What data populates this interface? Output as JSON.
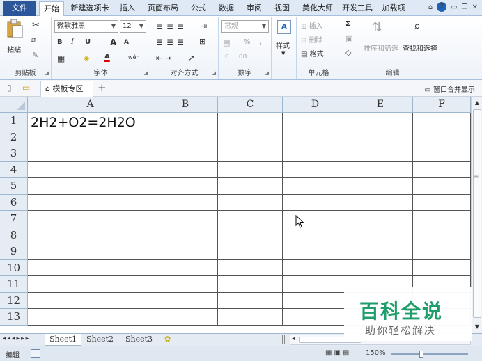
{
  "menu": {
    "file": "文件",
    "tabs": [
      "开始",
      "新建选项卡",
      "插入",
      "页面布局",
      "公式",
      "数据",
      "审阅",
      "视图",
      "美化大师",
      "开发工具",
      "加载项"
    ],
    "active_tab": "开始"
  },
  "ribbon": {
    "clipboard": {
      "paste": "粘贴",
      "label": "剪贴板"
    },
    "font": {
      "name": "微软雅黑",
      "size": "12",
      "bold": "B",
      "italic": "I",
      "underline": "U",
      "grow": "A",
      "shrink": "A",
      "font_color": "A",
      "phonetic": "wén",
      "label": "字体"
    },
    "alignment": {
      "label": "对齐方式"
    },
    "number": {
      "format": "常规",
      "percent": "%",
      "comma": ",",
      "label": "数字"
    },
    "styles": {
      "label": "样式"
    },
    "cells": {
      "insert": "插入",
      "delete": "删除",
      "format": "格式",
      "label": "单元格"
    },
    "editing": {
      "sigma": "Σ",
      "sort_filter": "排序和筛选",
      "find_select": "查找和选择",
      "label": "编辑"
    }
  },
  "docbar": {
    "tab_label": "模板专区",
    "merge_label": "窗口合并显示"
  },
  "grid": {
    "columns": [
      "A",
      "B",
      "C",
      "D",
      "E",
      "F"
    ],
    "rows": [
      "1",
      "2",
      "3",
      "4",
      "5",
      "6",
      "7",
      "8",
      "9",
      "10",
      "11",
      "12",
      "13"
    ],
    "a1_value": "2H2+O2=2H2O"
  },
  "sheets": {
    "tabs": [
      "Sheet1",
      "Sheet2",
      "Sheet3"
    ],
    "active": "Sheet1"
  },
  "status": {
    "mode": "编辑",
    "zoom": "150%"
  },
  "watermark": {
    "title": "百科全说",
    "subtitle": "助你轻松解决"
  },
  "colors": {
    "file_tab": "#2b579a",
    "header_bg": "#e6ecf4",
    "watermark_green": "#1e9e6a"
  }
}
